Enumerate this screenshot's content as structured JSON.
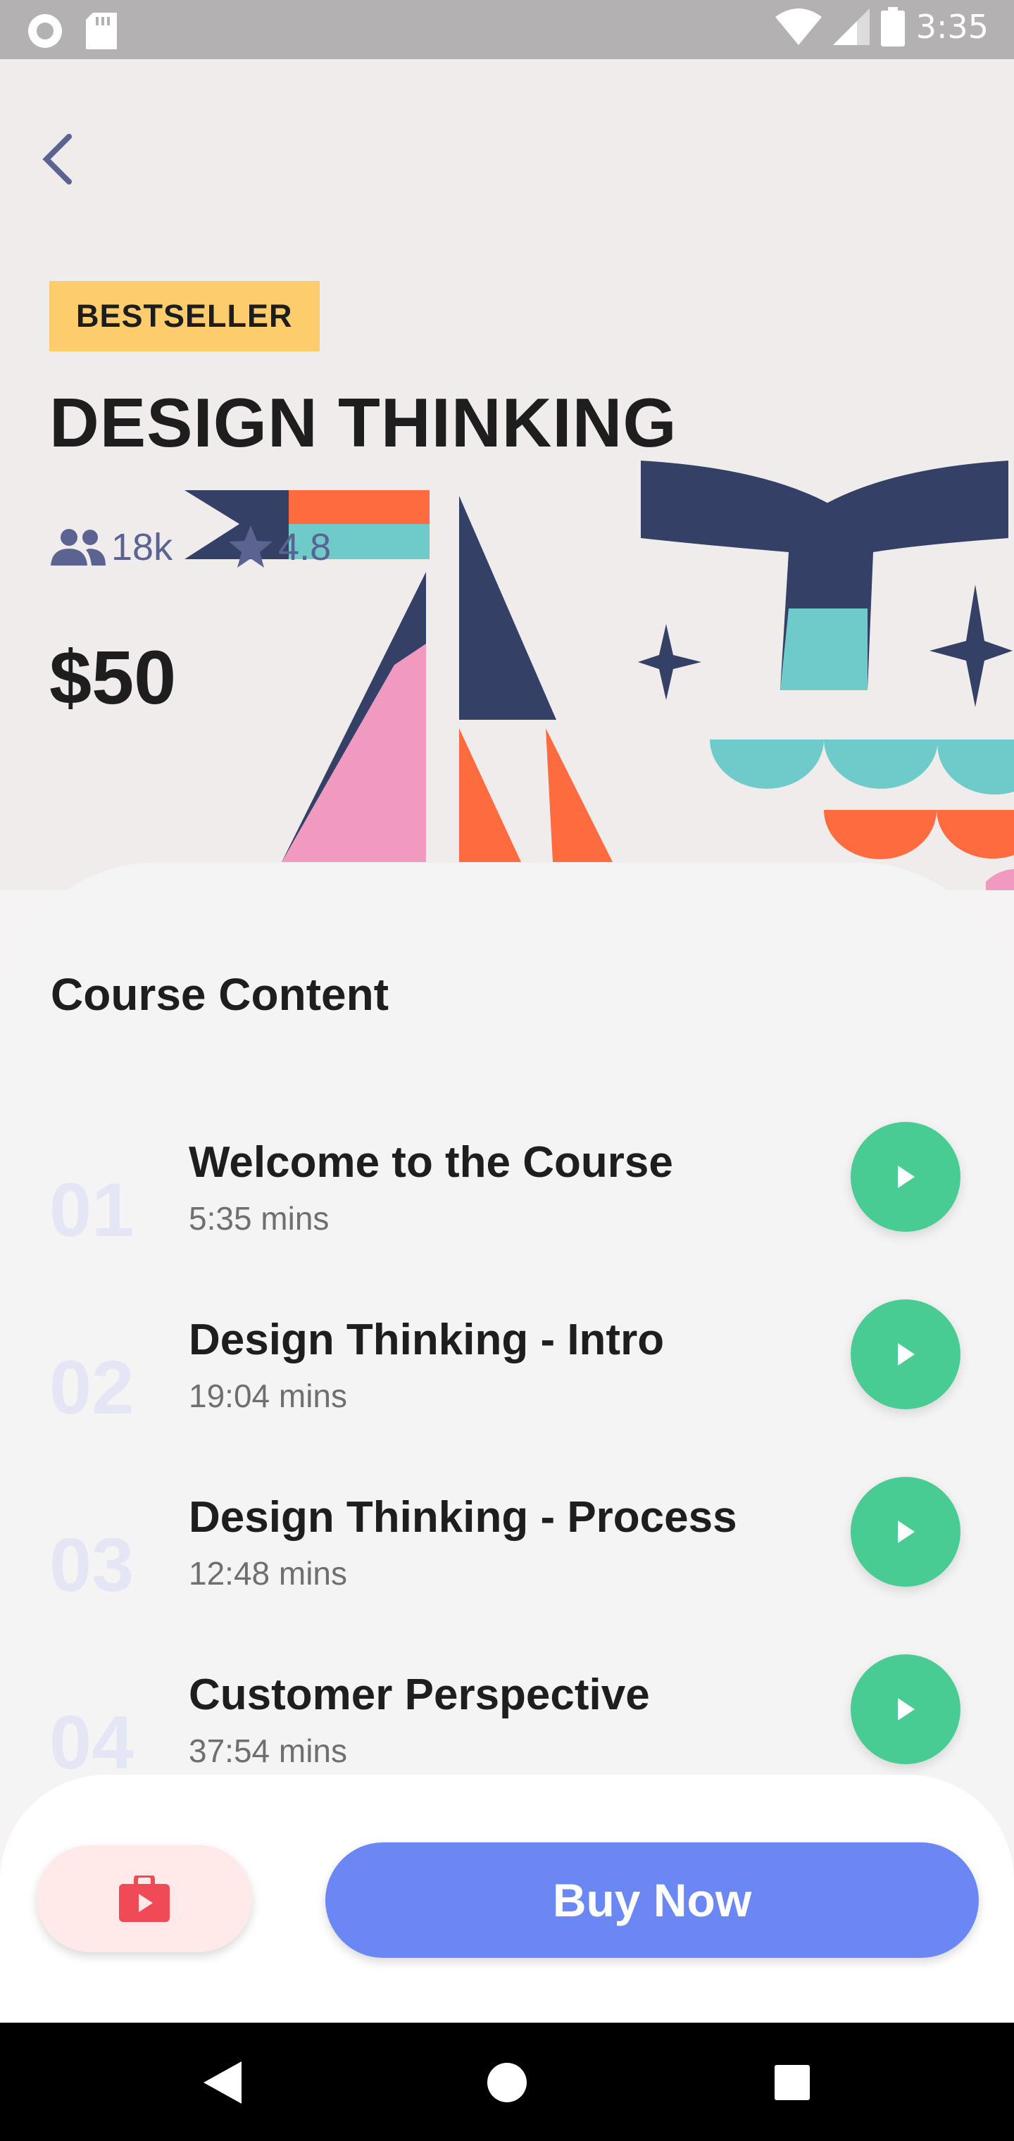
{
  "status_bar": {
    "time": "3:35"
  },
  "course": {
    "badge": "BESTSELLER",
    "title": "DESIGN THINKING",
    "students": "18k",
    "rating": "4.8",
    "price": "$50"
  },
  "content": {
    "section_title": "Course Content",
    "lessons": [
      {
        "number": "01",
        "title": "Welcome to the Course",
        "duration": "5:35 mins"
      },
      {
        "number": "02",
        "title": "Design Thinking - Intro",
        "duration": "19:04 mins"
      },
      {
        "number": "03",
        "title": "Design Thinking - Process",
        "duration": "12:48 mins"
      },
      {
        "number": "04",
        "title": "Customer Perspective",
        "duration": "37:54 mins"
      }
    ]
  },
  "bottom_bar": {
    "buy_label": "Buy Now"
  },
  "colors": {
    "accent_green": "#49cb94",
    "accent_blue": "#6b87f4",
    "badge_yellow": "#fdcd6d",
    "bag_red": "#ef4a55"
  }
}
